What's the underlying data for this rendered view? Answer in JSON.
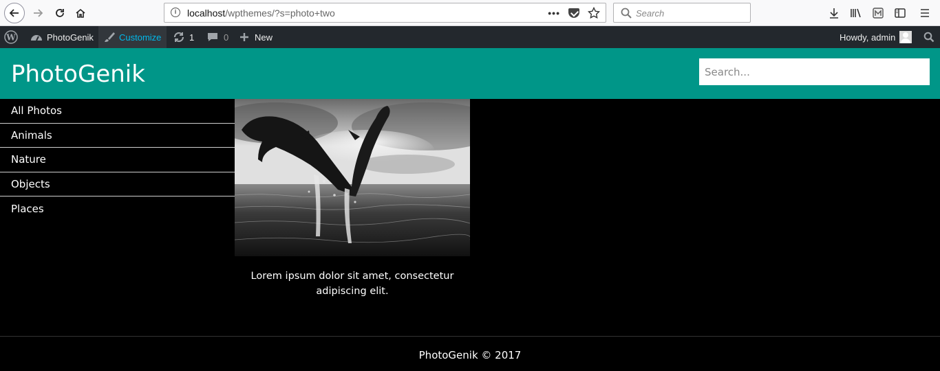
{
  "browser": {
    "url_host": "localhost",
    "url_path": "/wpthemes/?s=photo+two",
    "search_placeholder": "Search"
  },
  "adminbar": {
    "site_name": "PhotoGenik",
    "customize": "Customize",
    "updates_count": "1",
    "comments_count": "0",
    "new": "New",
    "howdy": "Howdy, admin"
  },
  "site": {
    "title": "PhotoGenik",
    "search_placeholder": "Search...",
    "header_color": "#009688"
  },
  "sidebar": {
    "items": [
      {
        "label": "All Photos"
      },
      {
        "label": "Animals"
      },
      {
        "label": "Nature"
      },
      {
        "label": "Objects"
      },
      {
        "label": "Places"
      }
    ]
  },
  "gallery": {
    "items": [
      {
        "caption": "Lorem ipsum dolor sit amet, consectetur adipiscing elit.",
        "image": "two dolphins jumping out of the sea, black and white"
      }
    ]
  },
  "footer": {
    "text": "PhotoGenik © 2017"
  }
}
